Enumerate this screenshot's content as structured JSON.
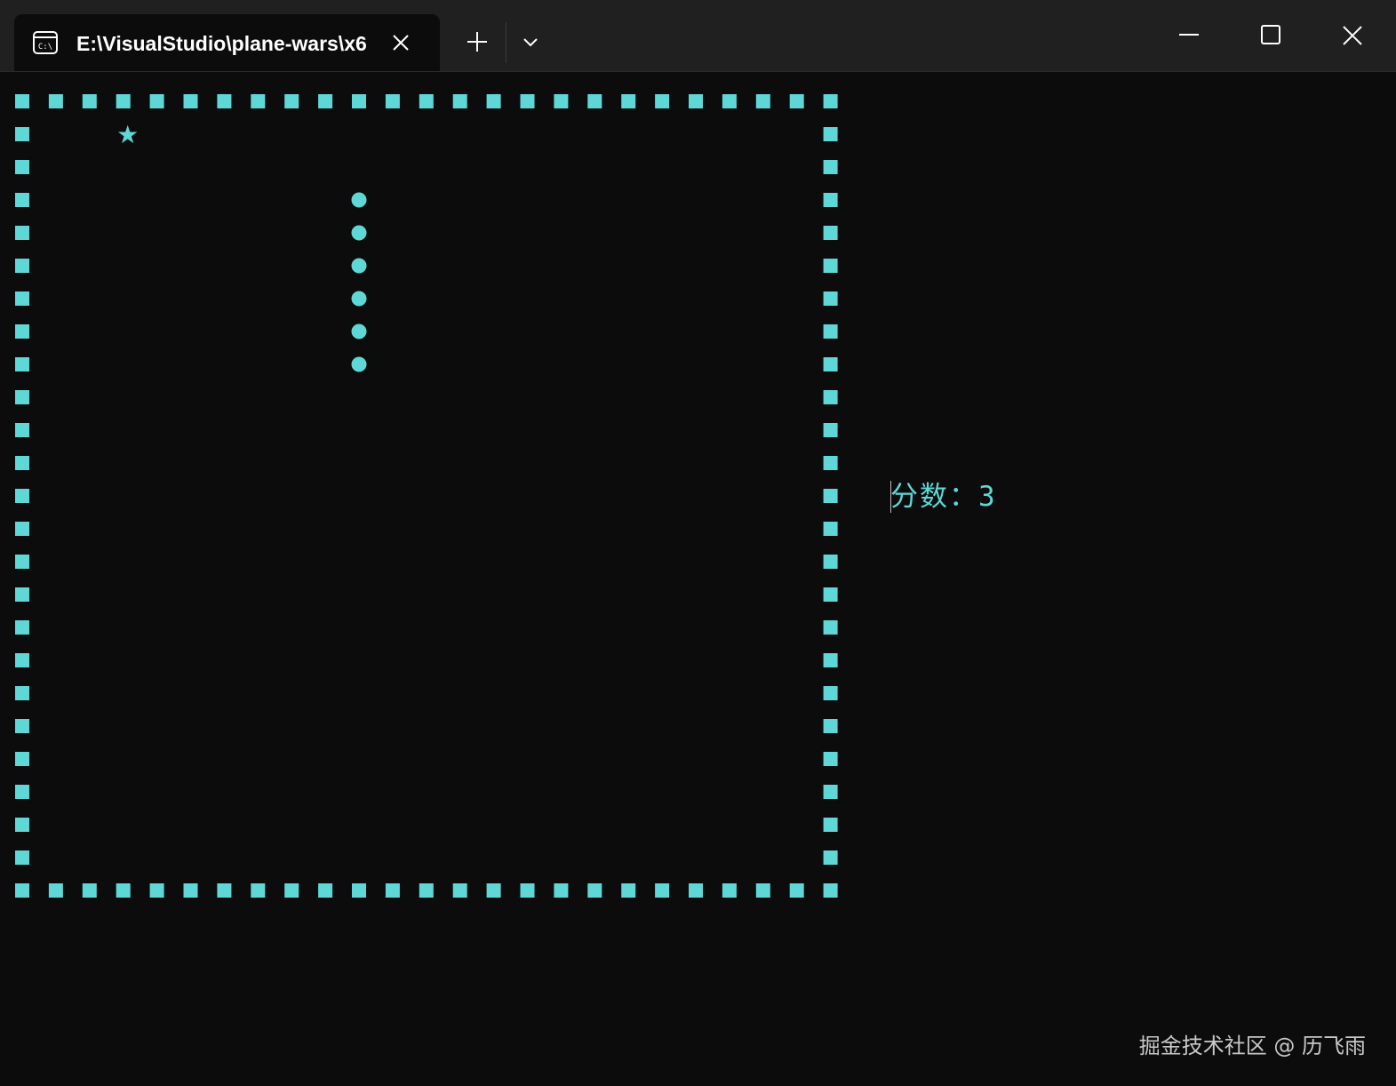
{
  "window": {
    "tab_title": "E:\\VisualStudio\\plane-wars\\x6",
    "tab_icon": "terminal-icon",
    "icons": {
      "tab_close": "close-icon",
      "new_tab": "plus-icon",
      "dropdown": "chevron-down-icon",
      "minimize": "minimize-icon",
      "maximize": "maximize-icon",
      "close": "close-icon"
    }
  },
  "game": {
    "wall_glyph": "■",
    "player_glyph": "★",
    "bullet_glyph": "●",
    "wall_columns": 25,
    "wall_rows": 25,
    "player": {
      "column": 3,
      "row": 1
    },
    "bullets": [
      {
        "column": 10,
        "row": 3
      },
      {
        "column": 10,
        "row": 4
      },
      {
        "column": 10,
        "row": 5
      },
      {
        "column": 10,
        "row": 6
      },
      {
        "column": 10,
        "row": 7
      },
      {
        "column": 10,
        "row": 8
      }
    ],
    "score_label": "分数：",
    "score_value": "3"
  },
  "watermark": "掘金技术社区 @ 历飞雨",
  "colors": {
    "accent": "#5fd7d7",
    "background": "#0c0c0c",
    "titlebar": "#202020"
  }
}
